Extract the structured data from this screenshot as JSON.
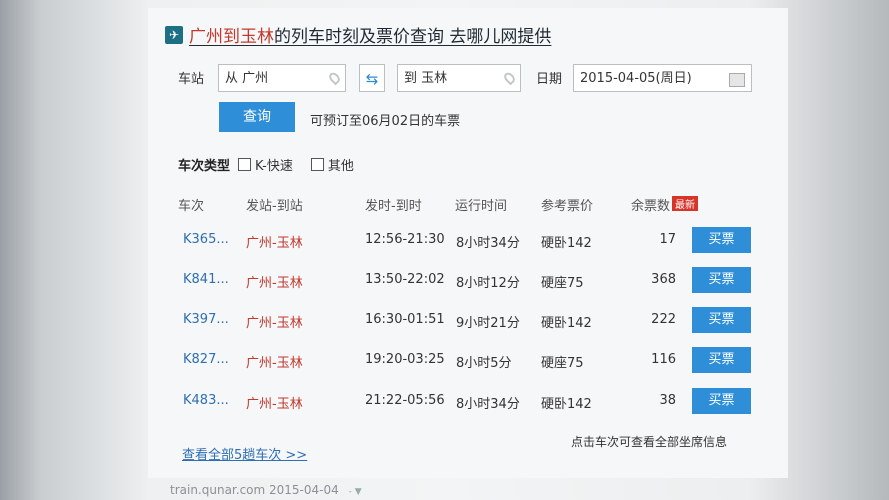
{
  "header": {
    "title_part1": "广州到玉林",
    "title_part2": "的列车时刻及票价查询 去哪儿网提供"
  },
  "search": {
    "station_label": "车站",
    "from_value": "从 广州",
    "to_value": "到 玉林",
    "date_label": "日期",
    "date_value": "2015-04-05(周日)",
    "query_button": "查询",
    "presale_note": "可预订至06月02日的车票"
  },
  "filters": {
    "label": "车次类型",
    "options": [
      "K-快速",
      "其他"
    ]
  },
  "table": {
    "headers": [
      "车次",
      "发站-到站",
      "发时-到时",
      "运行时间",
      "参考票价",
      "余票数"
    ],
    "hot_badge": "最新",
    "rows": [
      {
        "no": "K365...",
        "stations": "广州-玉林",
        "times": "12:56-21:30",
        "duration": "8小时34分",
        "price": "硬卧142",
        "remain": "17",
        "buy": "买票"
      },
      {
        "no": "K841...",
        "stations": "广州-玉林",
        "times": "13:50-22:02",
        "duration": "8小时12分",
        "price": "硬座75",
        "remain": "368",
        "buy": "买票"
      },
      {
        "no": "K397...",
        "stations": "广州-玉林",
        "times": "16:30-01:51",
        "duration": "9小时21分",
        "price": "硬卧142",
        "remain": "222",
        "buy": "买票"
      },
      {
        "no": "K827...",
        "stations": "广州-玉林",
        "times": "19:20-03:25",
        "duration": "8小时5分",
        "price": "硬座75",
        "remain": "116",
        "buy": "买票"
      },
      {
        "no": "K483...",
        "stations": "广州-玉林",
        "times": "21:22-05:56",
        "duration": "8小时34分",
        "price": "硬卧142",
        "remain": "38",
        "buy": "买票"
      }
    ],
    "more_link": "查看全部5趟车次 >>",
    "hint": "点击车次可查看全部坐席信息"
  },
  "footer": {
    "source": "train.qunar.com 2015-04-04",
    "extra": "- ▼"
  }
}
